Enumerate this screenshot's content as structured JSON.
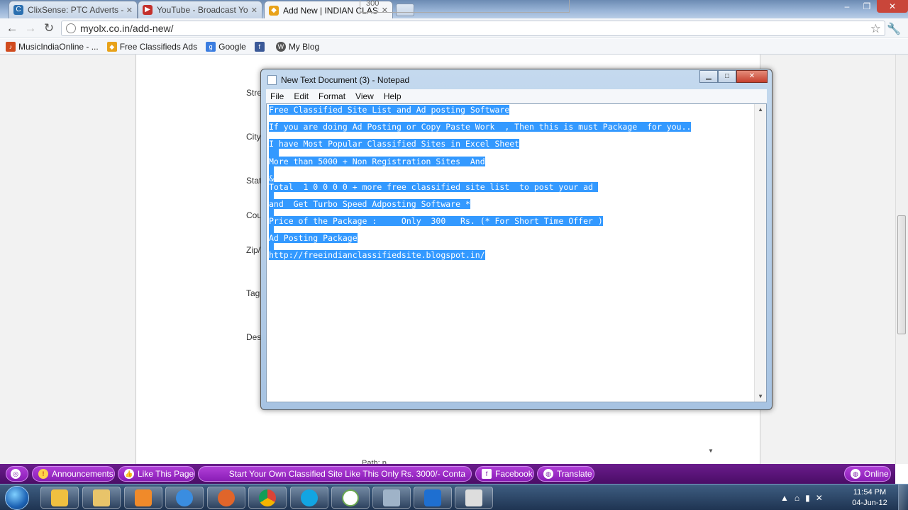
{
  "browser": {
    "tabs": [
      {
        "label": "ClixSense: PTC Adverts - Cli",
        "icon": "clixsense-icon",
        "icon_color": "#2a6fb0"
      },
      {
        "label": "YouTube - Broadcast Yours",
        "icon": "youtube-icon",
        "icon_color": "#c4302b"
      },
      {
        "label": "Add New | INDIAN CLASSIF",
        "icon": "tag-icon",
        "icon_color": "#e8a21a"
      }
    ],
    "url": "myolx.co.in/add-new/",
    "bookmarks": [
      {
        "label": "MusicIndiaOnline - ...",
        "icon": "music-icon",
        "icon_color": "#d04b1f"
      },
      {
        "label": "Free Classifieds Ads",
        "icon": "tag-icon",
        "icon_color": "#e8a21a"
      },
      {
        "label": "Google",
        "icon": "google-icon",
        "icon_color": "#3b7de0"
      },
      {
        "label": "",
        "icon": "facebook-icon",
        "icon_color": "#3b5998"
      },
      {
        "label": "My Blog",
        "icon": "wordpress-icon",
        "icon_color": "#555555"
      }
    ]
  },
  "form": {
    "top_value": "300",
    "labels": [
      "Stre",
      "City",
      "Stat",
      "Cou",
      "Zip/",
      "Tag",
      "Desc"
    ],
    "path_label": "Path: p"
  },
  "notepad": {
    "title": "New Text Document (3) - Notepad",
    "menu": [
      "File",
      "Edit",
      "Format",
      "View",
      "Help"
    ],
    "lines": [
      "Free Classified Site List and Ad posting Software",
      "If you are doing Ad Posting or Copy Paste Work  , Then this is must Package  for you..",
      "I have Most Popular Classified Sites in Excel Sheet",
      "More than 5000 + Non Registration Sites  And",
      "&",
      "Total  1 0 0 0 0 + more free classified site list  to post your ad ",
      "and  Get Turbo Speed Adposting Software *",
      "Price of the Package :     Only  300   Rs. (* For Short Time Offer )",
      "Ad Posting Package",
      "http://freeindianclassifiedsite.blogspot.in/"
    ],
    "selection_color": "#3399ff"
  },
  "sitebar": {
    "announcements": "Announcements",
    "like": "Like This Page",
    "ticker": "Start Your Own Classified Site Like This Only Rs. 3000/- Conta",
    "facebook": "Facebook",
    "translate": "Translate",
    "online": "Online",
    "color": "#8a1db6"
  },
  "taskbar": {
    "apps": [
      "explorer",
      "folder",
      "media-player",
      "internet-explorer",
      "firefox",
      "chrome",
      "skype",
      "google-talk",
      "app",
      "teamviewer",
      "camera"
    ],
    "time": "11:54 PM",
    "date": "04-Jun-12"
  }
}
